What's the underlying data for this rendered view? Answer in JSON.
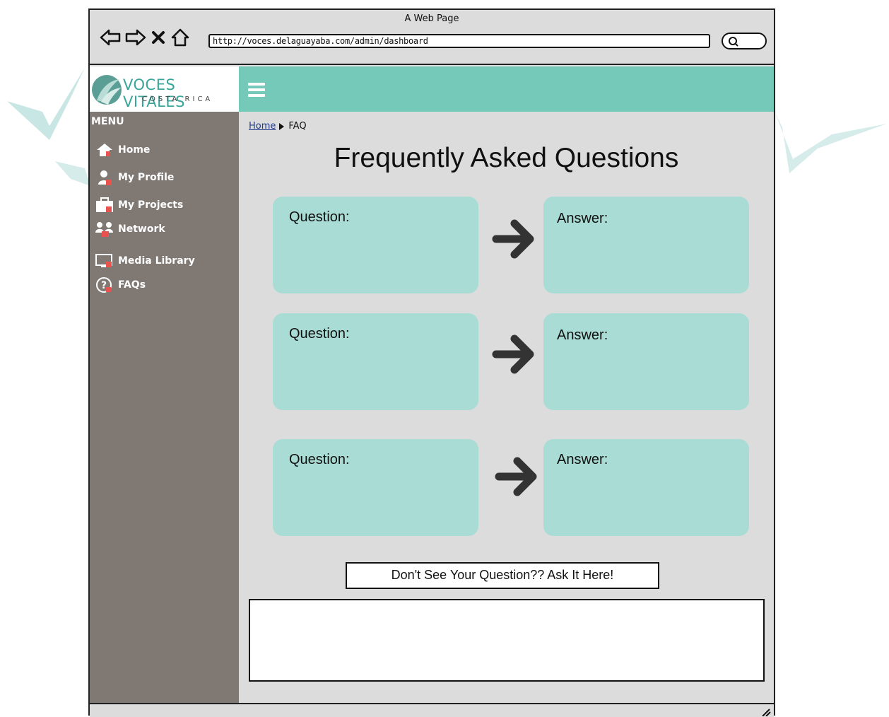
{
  "window": {
    "title": "A Web Page",
    "url": "http://voces.delaguayaba.com/admin/dashboard"
  },
  "brand": {
    "name": "VOCES VITALES",
    "subtitle": "COSTA RICA"
  },
  "colors": {
    "header_bg": "#74c9b9",
    "sidebar_bg": "#7f7873",
    "card_bg": "#a8dcd5",
    "content_bg": "#dcdcdc",
    "accent": "#e8524f"
  },
  "sidebar": {
    "menu_label": "MENU",
    "items": [
      {
        "label": "Home",
        "icon": "home-icon"
      },
      {
        "label": "My Profile",
        "icon": "user-icon"
      },
      {
        "label": "My Projects",
        "icon": "briefcase-icon"
      },
      {
        "label": "Network",
        "icon": "network-icon"
      },
      {
        "label": "Media Library",
        "icon": "monitor-icon"
      },
      {
        "label": "FAQs",
        "icon": "help-icon"
      }
    ]
  },
  "breadcrumb": {
    "home": "Home",
    "current": "FAQ"
  },
  "page": {
    "title": "Frequently Asked Questions"
  },
  "faq": [
    {
      "question_label": "Question:",
      "answer_label": "Answer:"
    },
    {
      "question_label": "Question:",
      "answer_label": "Answer:"
    },
    {
      "question_label": "Question:",
      "answer_label": "Answer:"
    }
  ],
  "ask": {
    "button_label": "Don't See Your Question?? Ask It Here!",
    "textarea_value": ""
  }
}
